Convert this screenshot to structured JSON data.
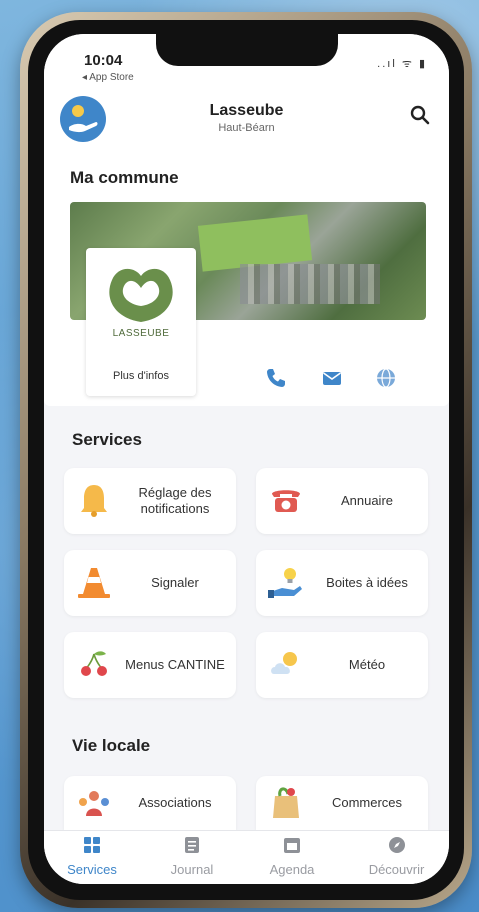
{
  "status": {
    "time": "10:04",
    "back_app": "◂ App Store",
    "icons": "..ıl ᯤ ▮"
  },
  "header": {
    "city": "Lasseube",
    "region": "Haut-Béarn"
  },
  "commune": {
    "title": "Ma commune",
    "logo_text": "LASSEUBE",
    "more_info": "Plus d'infos",
    "contact_icons": [
      "phone-icon",
      "mail-icon",
      "globe-icon"
    ]
  },
  "services": {
    "title": "Services",
    "tiles": [
      {
        "label": "Réglage des notifications",
        "icon": "bell-icon"
      },
      {
        "label": "Annuaire",
        "icon": "telephone-icon"
      },
      {
        "label": "Signaler",
        "icon": "traffic-cone-icon"
      },
      {
        "label": "Boites à idées",
        "icon": "idea-icon"
      },
      {
        "label": "Menus CANTINE",
        "icon": "cherries-icon"
      },
      {
        "label": "Météo",
        "icon": "weather-icon"
      }
    ]
  },
  "vie_locale": {
    "title": "Vie locale",
    "tiles": [
      {
        "label": "Associations",
        "icon": "people-icon"
      },
      {
        "label": "Commerces",
        "icon": "shopping-bag-icon"
      }
    ]
  },
  "tabbar": {
    "tabs": [
      {
        "label": "Services",
        "icon": "grid-icon",
        "active": true
      },
      {
        "label": "Journal",
        "icon": "journal-icon",
        "active": false
      },
      {
        "label": "Agenda",
        "icon": "calendar-icon",
        "active": false
      },
      {
        "label": "Découvrir",
        "icon": "compass-icon",
        "active": false
      }
    ]
  },
  "colors": {
    "accent": "#3f86c9",
    "brand_green": "#6a8f4b",
    "background": "#f4f5f8"
  }
}
